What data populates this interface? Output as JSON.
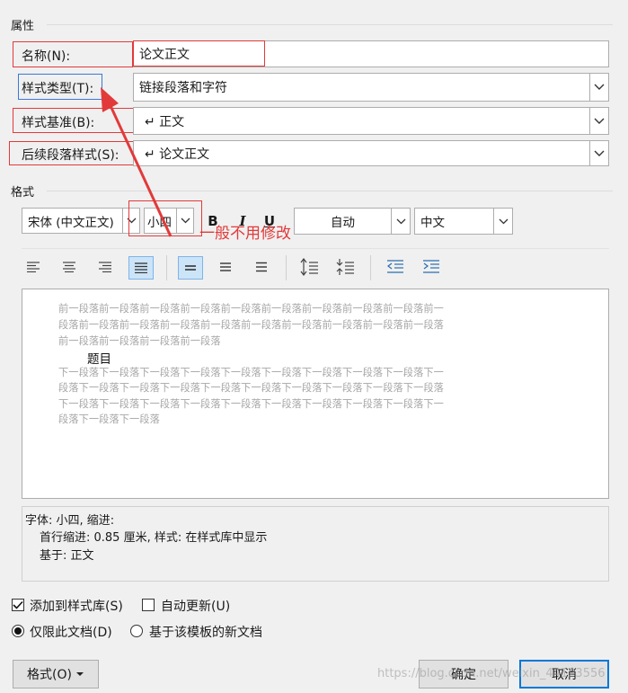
{
  "properties": {
    "section_label": "属性",
    "name_label": "名称(N):",
    "name_value": "论文正文",
    "style_type_label": "样式类型(T):",
    "style_type_value": "链接段落和字符",
    "style_based_label": "样式基准(B):",
    "style_based_value": "↵ 正文",
    "next_style_label": "后续段落样式(S):",
    "next_style_value": "↵ 论文正文"
  },
  "format": {
    "section_label": "格式",
    "font_name": "宋体 (中文正文)",
    "font_size": "小四",
    "bold": "B",
    "italic": "I",
    "underline": "U",
    "color": "自动",
    "script": "中文"
  },
  "annotation": {
    "text": "一般不用修改",
    "color": "#e23a3a"
  },
  "preview": {
    "prev_lines": [
      "前一段落前一段落前一段落前一段落前一段落前一段落前一段落前一段落前一段落前一",
      "段落前一段落前一段落前一段落前一段落前一段落前一段落前一段落前一段落前一段落",
      "前一段落前一段落前一段落前一段落"
    ],
    "sample_text": "题目",
    "next_lines": [
      "下一段落下一段落下一段落下一段落下一段落下一段落下一段落下一段落下一段落下一",
      "段落下一段落下一段落下一段落下一段落下一段落下一段落下一段落下一段落下一段落",
      "下一段落下一段落下一段落下一段落下一段落下一段落下一段落下一段落下一段落下一",
      "段落下一段落下一段落"
    ]
  },
  "description": {
    "line1": "字体: 小四, 缩进:",
    "line2": "首行缩进:  0.85 厘米, 样式: 在样式库中显示",
    "line3": "基于: 正文"
  },
  "options": {
    "add_to_gallery": "添加到样式库(S)",
    "add_to_gallery_checked": true,
    "auto_update": "自动更新(U)",
    "auto_update_checked": false,
    "only_this_doc": "仅限此文档(D)",
    "new_docs_template": "基于该模板的新文档",
    "selected_scope": "only_this_doc"
  },
  "buttons": {
    "format": "格式(O)",
    "ok": "确定",
    "cancel": "取消"
  },
  "watermark": "https://blog.csdn.net/weixin_44123556"
}
